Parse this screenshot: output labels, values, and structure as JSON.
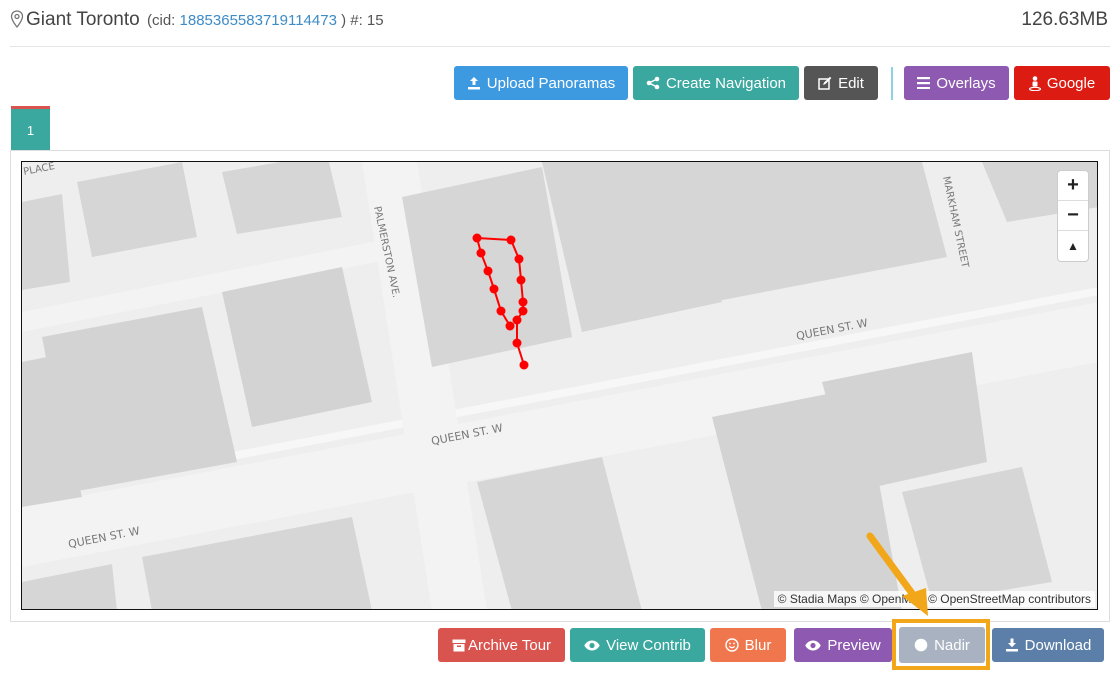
{
  "header": {
    "title": "Giant Toronto",
    "cid_prefix": "(cid: ",
    "cid_value": "1885365583719114473",
    "cid_suffix": " ) #: 15",
    "size": "126.63MB"
  },
  "toolbar": {
    "upload_label": "Upload Panoramas",
    "create_nav_label": "Create Navigation",
    "edit_label": "Edit",
    "overlays_label": "Overlays",
    "google_label": "Google"
  },
  "tabs": [
    {
      "label": "1"
    }
  ],
  "map": {
    "zoom_in": "+",
    "zoom_out": "−",
    "reset_north": "▲",
    "attribution": "© Stadia Maps © OpenMap  © OpenStreetMap contributors",
    "street_labels": {
      "queen_upper": "QUEEN ST. W",
      "queen_middle": "QUEEN ST. W",
      "queen_lower": "QUEEN ST. W",
      "palmerston": "PALMERSTON AVE.",
      "markham": "MARKHAM STREET",
      "place": "PLACE"
    },
    "route_color": "#ff0000"
  },
  "actions": {
    "archive_label": "Archive Tour",
    "view_contrib_label": "View Contrib",
    "blur_label": "Blur",
    "preview_label": "Preview",
    "nadir_label": "Nadir",
    "download_label": "Download"
  },
  "colors": {
    "upload": "#3d9ae0",
    "create_nav": "#3aa89f",
    "edit": "#555555",
    "overlays": "#8e59b0",
    "google": "#dc1b12",
    "archive": "#d9534f",
    "view_contrib": "#3aa89f",
    "blur": "#f0774d",
    "preview": "#8e59b0",
    "nadir": "#a8b2c0",
    "download": "#5b7fa8",
    "highlight": "#f2a71b"
  }
}
